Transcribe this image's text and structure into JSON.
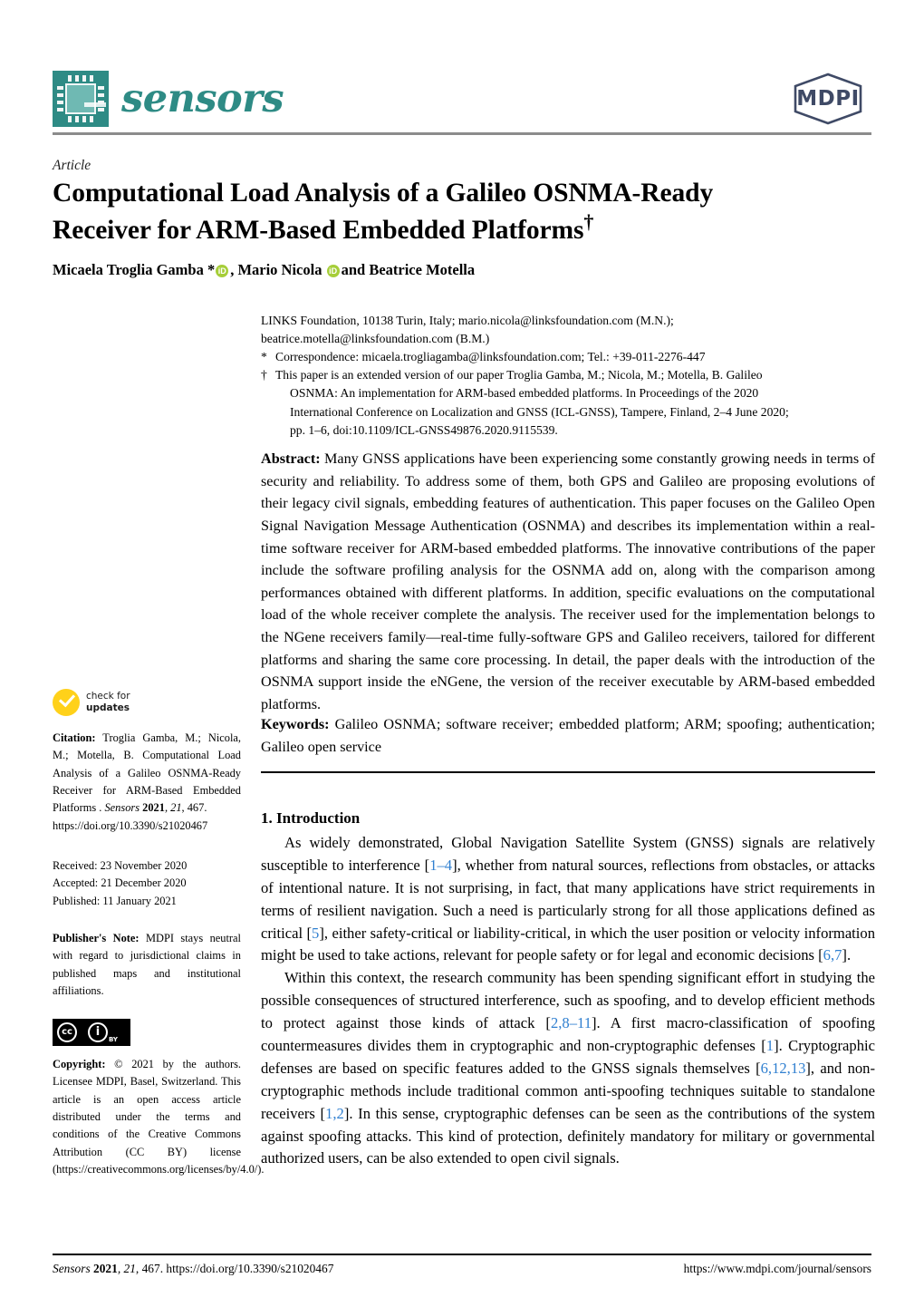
{
  "header": {
    "journal_name": "sensors",
    "publisher_logo_text": "MDPI"
  },
  "article": {
    "type_label": "Article",
    "title_line1": "Computational Load Analysis of a Galileo OSNMA-Ready",
    "title_line2": "Receiver for ARM-Based Embedded Platforms",
    "title_dagger": "†",
    "authors_part1": "Micaela Troglia Gamba *",
    "authors_part2": ", Mario Nicola",
    "authors_part3": " and Beatrice Motella",
    "orcid_glyph": "iD"
  },
  "affiliation": {
    "line1": "LINKS Foundation, 10138 Turin, Italy; mario.nicola@linksfoundation.com (M.N.);",
    "line2": "beatrice.motella@linksfoundation.com (B.M.)",
    "correspondence_marker": "*",
    "correspondence": "Correspondence: micaela.trogliagamba@linksfoundation.com; Tel.: +39-011-2276-447",
    "dagger_marker": "†",
    "dagger_note_line1": "This paper is an extended version of our paper Troglia Gamba, M.; Nicola, M.; Motella, B. Galileo",
    "dagger_note_line2": "OSNMA: An implementation for ARM-based embedded platforms. In Proceedings of the 2020",
    "dagger_note_line3": "International Conference on Localization and GNSS (ICL-GNSS), Tampere, Finland, 2–4 June 2020;",
    "dagger_note_line4": "pp. 1–6, doi:10.1109/ICL-GNSS49876.2020.9115539."
  },
  "abstract": {
    "label": "Abstract:",
    "text": " Many GNSS applications have been experiencing some constantly growing needs in terms of security and reliability. To address some of them, both GPS and Galileo are proposing evolutions of their legacy civil signals, embedding features of authentication. This paper focuses on the Galileo Open Signal Navigation Message Authentication (OSNMA) and describes its implementation within a real-time software receiver for ARM-based embedded platforms. The innovative contributions of the paper include the software profiling analysis for the OSNMA add on, along with the comparison among performances obtained with different platforms. In addition, specific evaluations on the computational load of the whole receiver complete the analysis. The receiver used for the implementation belongs to the NGene receivers family—real-time fully-software GPS and Galileo receivers, tailored for different platforms and sharing the same core processing. In detail, the paper deals with the introduction of the OSNMA support inside the eNGene, the version of the receiver executable by ARM-based embedded platforms."
  },
  "keywords": {
    "label": "Keywords:",
    "text": " Galileo OSNMA; software receiver; embedded platform; ARM; spoofing; authentication; Galileo open service"
  },
  "introduction": {
    "heading": "1. Introduction",
    "paragraph1_a": "As widely demonstrated, Global Navigation Satellite System (GNSS) signals are relatively susceptible to interference [",
    "p1_ref1": "1–4",
    "paragraph1_b": "], whether from natural sources, reflections from obstacles, or attacks of intentional nature. It is not surprising, in fact, that many applications have strict requirements in terms of resilient navigation. Such a need is particularly strong for all those applications defined as critical [",
    "p1_ref2": "5",
    "paragraph1_c": "], either safety-critical or liability-critical, in which the user position or velocity information might be used to take actions, relevant for people safety or for legal and economic decisions [",
    "p1_ref3": "6,7",
    "paragraph1_d": "].",
    "paragraph2_a": "Within this context, the research community has been spending significant effort in studying the possible consequences of structured interference, such as spoofing, and to develop efficient methods to protect against those kinds of attack [",
    "p2_ref1": "2,8–11",
    "paragraph2_b": "]. A first macro-classification of spoofing countermeasures divides them in cryptographic and non-cryptographic defenses [",
    "p2_ref2": "1",
    "paragraph2_c": "]. Cryptographic defenses are based on specific features added to the GNSS signals themselves [",
    "p2_ref3": "6,12,13",
    "paragraph2_d": "], and non-cryptographic methods include traditional common anti-spoofing techniques suitable to standalone receivers [",
    "p2_ref4": "1,2",
    "paragraph2_e": "]. In this sense, cryptographic defenses can be seen as the contributions of the system against spoofing attacks. This kind of protection, definitely mandatory for military or governmental authorized users, can be also extended to open civil signals."
  },
  "sidebar": {
    "check_line1": "check for",
    "check_line2": "updates",
    "citation_label": "Citation:",
    "citation_text": " Troglia Gamba, M.; Nicola, M.; Motella, B. Computational Load Analysis of a Galileo OSNMA-Ready Receiver for ARM-Based Embedded Platforms . ",
    "citation_journal": "Sensors",
    "citation_year": " 2021",
    "citation_vol": ", 21",
    "citation_pages": ",  467.",
    "citation_doi": "https://doi.org/10.3390/s21020467",
    "received": "Received: 23 November 2020",
    "accepted": "Accepted: 21 December 2020",
    "published": "Published: 11 January 2021",
    "note_label": "Publisher's Note:",
    "note_text": " MDPI stays neutral with regard to jurisdictional claims in published maps and institutional affiliations.",
    "cc_glyph1": "cc",
    "cc_glyph2": "i",
    "cc_by": "BY",
    "copyright_label": "Copyright:",
    "copyright_text": " © 2021 by the authors. Licensee MDPI, Basel, Switzerland. This article is an open access article distributed under the terms and conditions of the Creative Commons Attribution (CC BY)  license (https://creativecommons.org/licenses/by/4.0/)."
  },
  "footer": {
    "journal": "Sensors",
    "year": " 2021",
    "volume": ", 21",
    "article_no": ", 467. ",
    "doi": "https://doi.org/10.3390/s21020467",
    "url": "https://www.mdpi.com/journal/sensors"
  },
  "colors": {
    "brand_teal": "#2e8b85",
    "mdpi_navy": "#3f4a66",
    "orcid_green": "#a6ce39",
    "check_yellow": "#ffd11a",
    "reference_blue": "#2f7fd0"
  }
}
